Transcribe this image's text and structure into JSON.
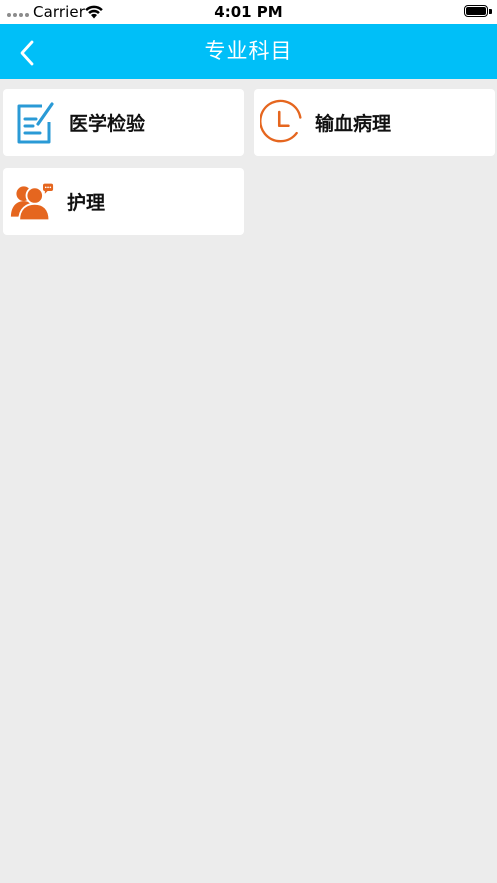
{
  "status_bar": {
    "carrier": "Carrier",
    "time": "4:01 PM"
  },
  "nav": {
    "title": "专业科目",
    "back_icon": "chevron-left-icon",
    "background": "#00bff8"
  },
  "subjects": [
    {
      "label": "医学检验",
      "icon": "edit-note-icon",
      "icon_color": "#2a9ad6"
    },
    {
      "label": "输血病理",
      "icon": "clock-icon",
      "icon_color": "#e5661f"
    },
    {
      "label": "护理",
      "icon": "people-chat-icon",
      "icon_color": "#e5661f"
    }
  ]
}
